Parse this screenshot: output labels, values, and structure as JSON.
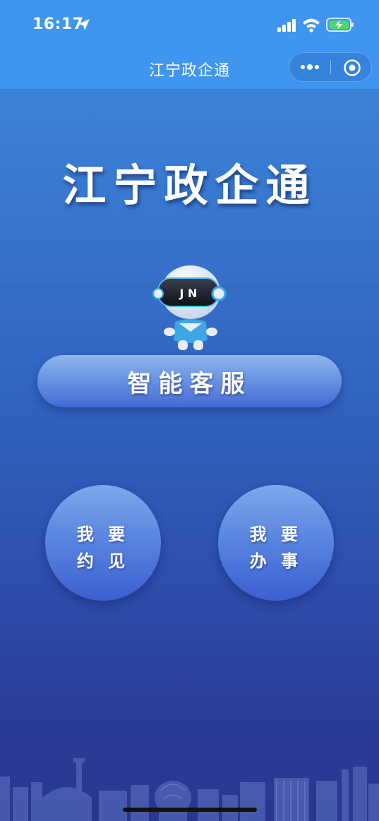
{
  "status_bar": {
    "time": "16:17",
    "icons": [
      "location-arrow-icon",
      "cellular-signal-icon",
      "wifi-icon",
      "battery-charging-icon"
    ]
  },
  "nav": {
    "title": "江宁政企通",
    "capsule_icons": [
      "more-dots-icon",
      "close-target-icon"
    ]
  },
  "hero": {
    "title": "江宁政企通",
    "mascot_badge": "J N"
  },
  "service": {
    "label": "智能客服"
  },
  "actions": {
    "appointment": {
      "line1": "我 要",
      "line2": "约 见"
    },
    "handle_affairs": {
      "line1": "我 要",
      "line2": "办 事"
    }
  },
  "colors": {
    "nav_bg": "#3f95f0",
    "bg_top": "#3f8fe6",
    "bg_bottom": "#2a368f",
    "button_top": "#8fb6ec",
    "button_bottom": "#4569d6"
  }
}
